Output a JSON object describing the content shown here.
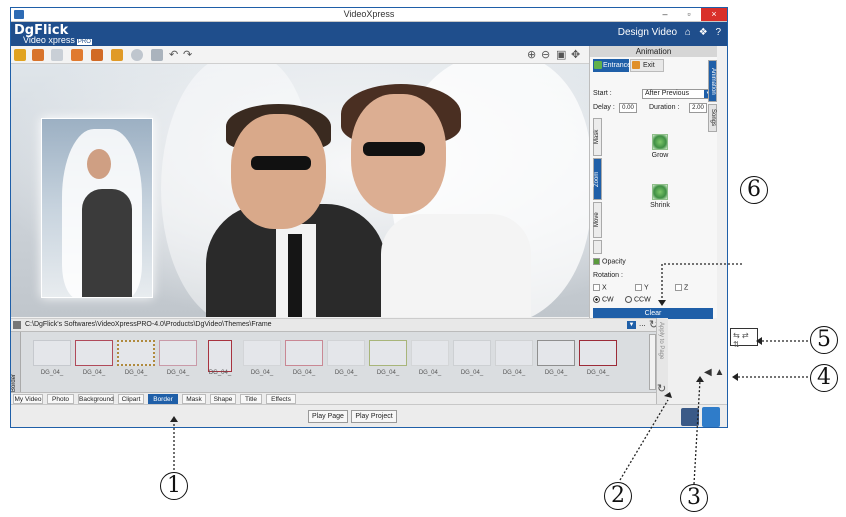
{
  "window": {
    "title": "VideoXpress",
    "controls": [
      "–",
      "▫",
      "×"
    ]
  },
  "header": {
    "logo": "DgFlick",
    "product": "Video xpress",
    "edition": "PRO",
    "mode_label": "Design Video",
    "icons": [
      "home-icon",
      "wrench-icon",
      "help-icon"
    ],
    "help_glyph": "?"
  },
  "animation_panel": {
    "title": "Animation",
    "tabs": [
      "Entrance",
      "Exit"
    ],
    "start_label": "Start :",
    "start_value": "After Previous",
    "delay_label": "Delay :",
    "delay_value": "0.00",
    "duration_label": "Duration :",
    "duration_value": "2.00",
    "vertical_tabs": [
      "Mask",
      "Zoom",
      "Move"
    ],
    "effects": [
      "Grow",
      "Shrink"
    ],
    "opacity_label": "Opacity",
    "rotation_label": "Rotation :",
    "axes": [
      "X",
      "Y",
      "Z"
    ],
    "directions": [
      "CW",
      "CCW"
    ],
    "clear_label": "Clear",
    "side_tabs": [
      "Animation",
      "Songs"
    ]
  },
  "path_bar": {
    "path": "C:\\DgFlick's Softwares\\VideoXpressPRO-4.0\\Products\\DgVideo\\Themes\\Frame",
    "more": "..."
  },
  "thumbnails": {
    "labels": [
      "DG_04_",
      "DG_04_",
      "DG_04_",
      "DG_04_",
      "DG_04_",
      "DG_04_",
      "DG_04_",
      "DG_04_",
      "DG_04_",
      "DG_04_",
      "DG_04_",
      "DG_04_",
      "DG_04_",
      "DG_04_"
    ]
  },
  "left_vertical_label": "Border",
  "bottom_tabs": [
    "My Video",
    "Photo",
    "Background",
    "Clipart",
    "Border",
    "Mask",
    "Shape",
    "Title",
    "Effects"
  ],
  "active_bottom_tab": "Border",
  "play": {
    "page": "Play Page",
    "project": "Play Project"
  },
  "side_options_label": "Apply to Page",
  "callouts": [
    "1",
    "2",
    "3",
    "4",
    "5",
    "6"
  ],
  "colors": {
    "brand_blue": "#1f4e8c",
    "accent_blue": "#1f5fa8",
    "close_red": "#d9302a"
  }
}
